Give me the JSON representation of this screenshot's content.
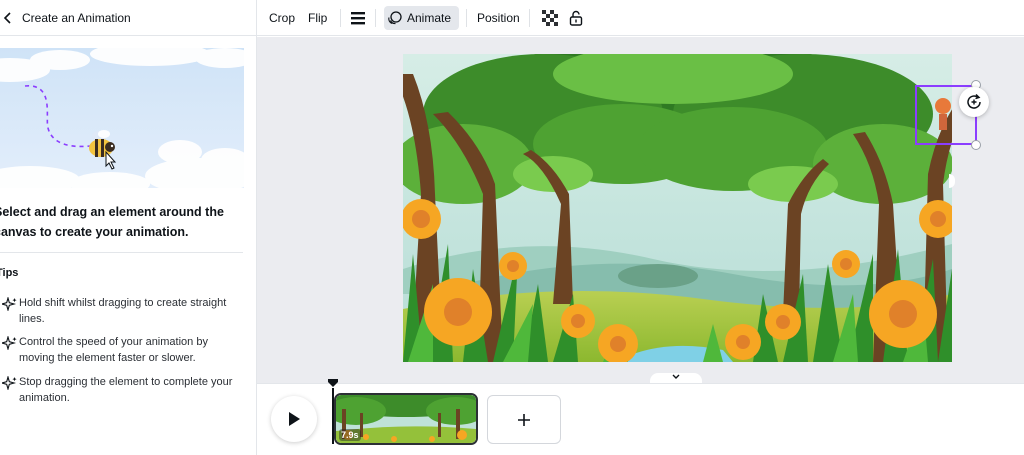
{
  "panel": {
    "title": "Create an Animation",
    "instruction": "Select and drag an element around the canvas to create your animation.",
    "tips_heading": "Tips",
    "tips": [
      "Hold shift whilst dragging to create straight lines.",
      "Control the speed of your animation by moving the element faster or slower.",
      "Stop dragging the element to complete your animation."
    ]
  },
  "toolbar": {
    "crop": "Crop",
    "flip": "Flip",
    "animate": "Animate",
    "position": "Position"
  },
  "timeline": {
    "duration": "7.9s"
  },
  "colors": {
    "accent": "#8b3dff",
    "active_bg": "#e4e7ec",
    "canvas_bg": "#ebecf0"
  }
}
